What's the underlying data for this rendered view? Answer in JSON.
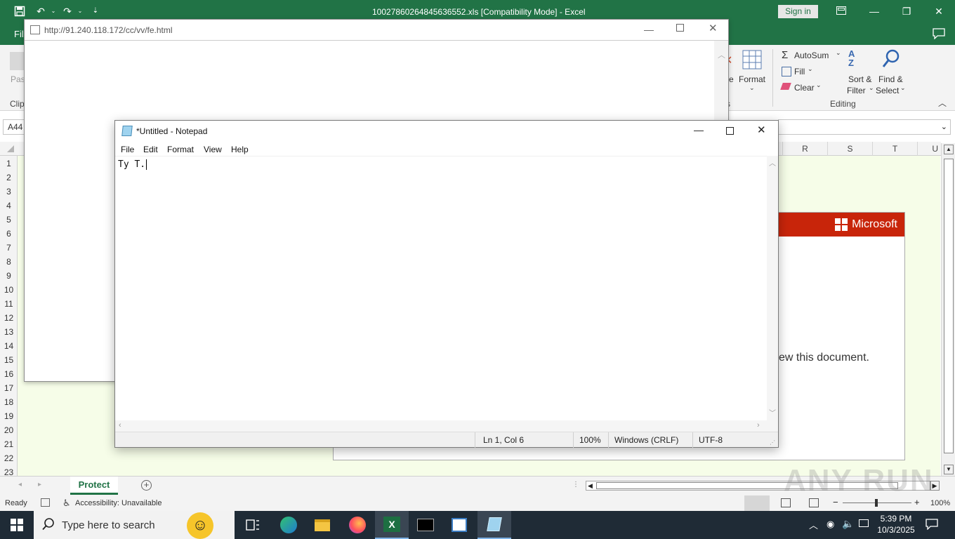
{
  "excel": {
    "title": "10027860264845636552.xls  [Compatibility Mode]  -  Excel",
    "sign_in": "Sign in",
    "file_tab": "File",
    "ribbon": {
      "paste": "Paste",
      "clipboard": "Clip",
      "format": "Format",
      "format_prefix": "e",
      "autosum": "AutoSum",
      "fill": "Fill",
      "clear": "Clear",
      "sort_filter_1": "Sort &",
      "sort_filter_2": "Filter",
      "find_select_1": "Find &",
      "find_select_2": "Select",
      "editing_label": "Editing",
      "cells_label": "s"
    },
    "name_box": "A44",
    "columns": [
      "R",
      "S",
      "T",
      "U"
    ],
    "rows": [
      "1",
      "2",
      "3",
      "4",
      "5",
      "6",
      "7",
      "8",
      "9",
      "10",
      "11",
      "12",
      "13",
      "14",
      "15",
      "16",
      "17",
      "18",
      "19",
      "20",
      "21",
      "22",
      "23"
    ],
    "notice_brand": "Microsoft",
    "notice_text": "ew this document.",
    "sheet_tab": "Protect",
    "status": {
      "ready": "Ready",
      "accessibility": "Accessibility: Unavailable",
      "zoom": "100%"
    }
  },
  "browser": {
    "url": "http://91.240.118.172/cc/vv/fe.html"
  },
  "notepad": {
    "title": "*Untitled - Notepad",
    "menu": [
      "File",
      "Edit",
      "Format",
      "View",
      "Help"
    ],
    "content": "Ty T.",
    "status": {
      "position": "Ln 1, Col 6",
      "zoom": "100%",
      "line_ending": "Windows (CRLF)",
      "encoding": "UTF-8"
    }
  },
  "taskbar": {
    "search_placeholder": "Type here to search",
    "time": "5:39 PM",
    "date": "10/3/2025"
  },
  "watermark": "ANY RUN",
  "colors": {
    "excel_green": "#217346",
    "ms_red": "#c8250a",
    "sheet_bg": "#f6fde8",
    "taskbar": "#1f2b36"
  }
}
